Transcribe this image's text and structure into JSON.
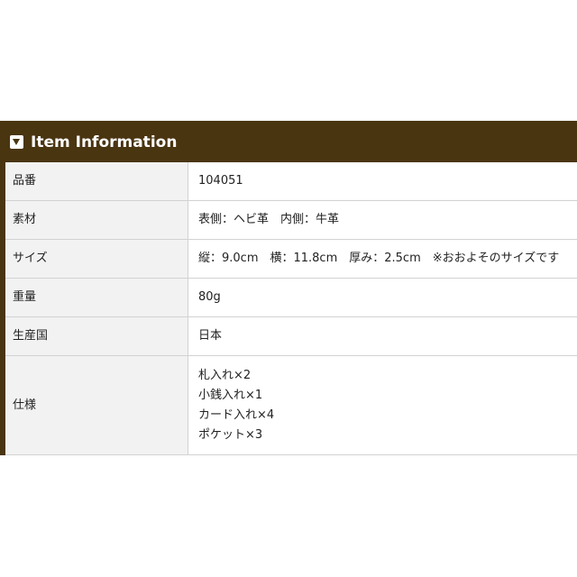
{
  "header": {
    "title": "Item Information",
    "icon": "caret-down-box-icon"
  },
  "colors": {
    "header_bg": "#4a3511",
    "label_bg": "#f2f2f2",
    "value_bg": "#ffffff",
    "border": "#d2d2d2"
  },
  "rows": [
    {
      "label": "品番",
      "value": "104051"
    },
    {
      "label": "素材",
      "value": "表側：ヘビ革　内側：牛革"
    },
    {
      "label": "サイズ",
      "value": "縦：9.0cm　横：11.8cm　厚み：2.5cm　※おおよそのサイズです"
    },
    {
      "label": "重量",
      "value": "80g"
    },
    {
      "label": "生産国",
      "value": "日本"
    },
    {
      "label": "仕様",
      "values": [
        "札入れ×2",
        "小銭入れ×1",
        "カード入れ×4",
        "ポケット×3"
      ]
    }
  ]
}
